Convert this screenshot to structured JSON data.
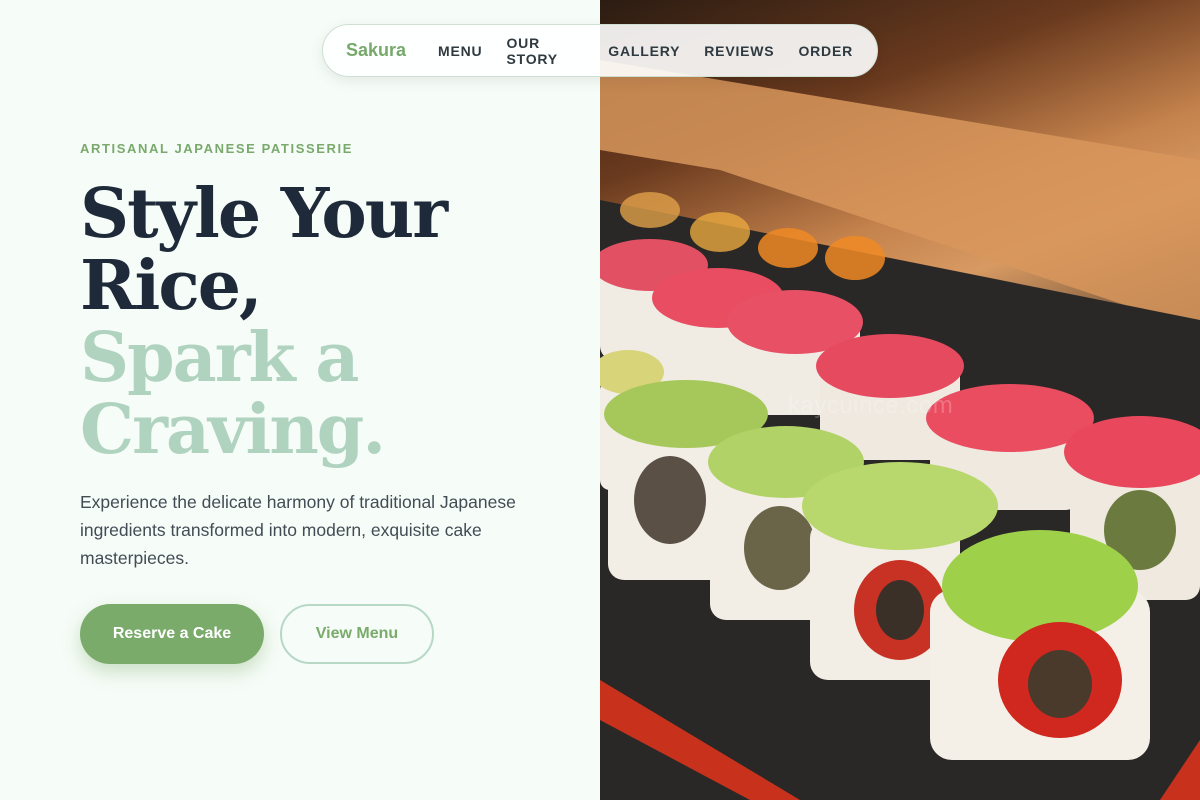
{
  "nav": {
    "brand": "Sakura",
    "items": [
      "MENU",
      "OUR STORY",
      "GALLERY",
      "REVIEWS",
      "ORDER"
    ]
  },
  "hero": {
    "eyebrow": "ARTISANAL JAPANESE PATISSERIE",
    "headline_line1": "Style Your",
    "headline_line2": "Rice,",
    "headline_line3": "Spark a",
    "headline_line4": "Craving.",
    "description": "Experience the delicate harmony of traditional Japanese ingredients transformed into modern, exquisite cake masterpieces.",
    "primary_cta": "Reserve a Cake",
    "secondary_cta": "View Menu"
  },
  "image": {
    "subject": "sushi-rolls-photo",
    "watermark": "kaycuince.com"
  },
  "colors": {
    "accent_green": "#7aab6b",
    "headline_dark": "#1e2a3a",
    "headline_light": "#b0d3c0",
    "background": "#f6fcf7"
  }
}
